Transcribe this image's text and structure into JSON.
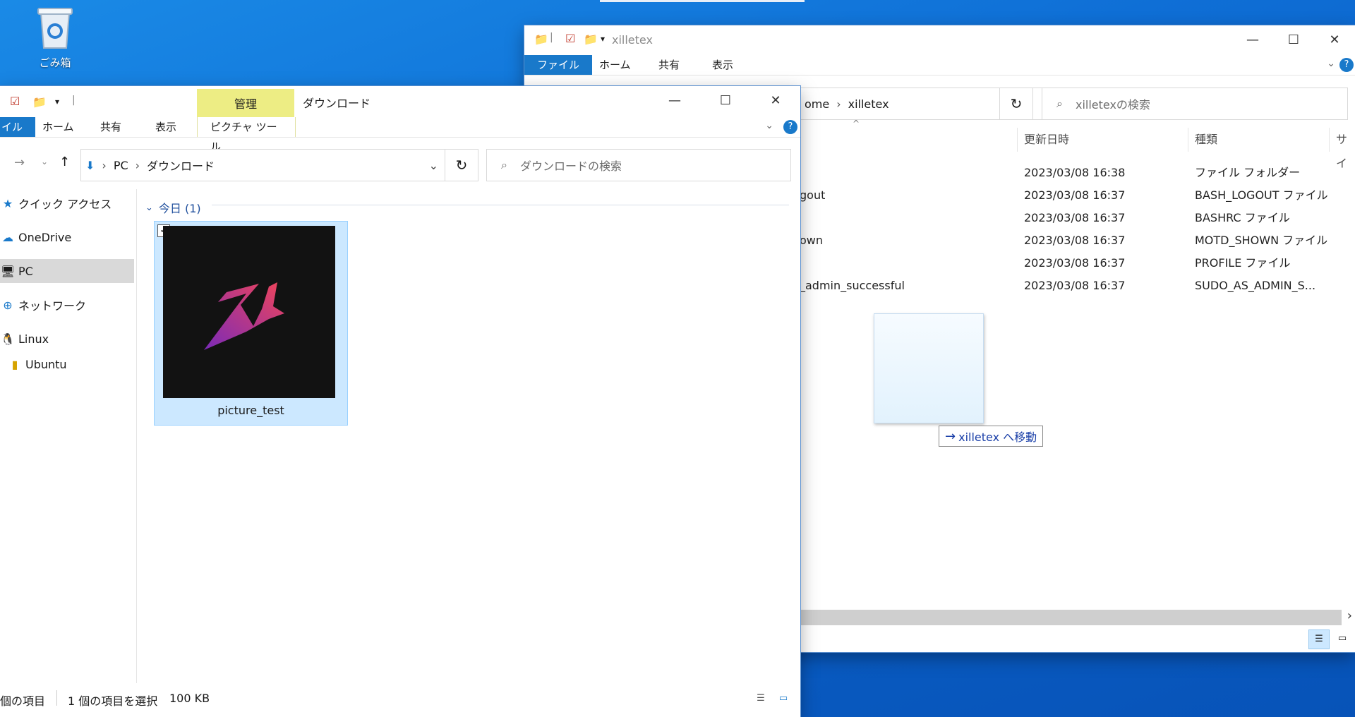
{
  "desktop": {
    "recycle_bin_label": "ごみ箱"
  },
  "back_window": {
    "title": "xilletex",
    "tabs": [
      "ファイル",
      "ホーム",
      "共有",
      "表示"
    ],
    "breadcrumb_prefix": "ome",
    "breadcrumb_current": "xilletex",
    "search_placeholder": "xilletexの検索",
    "columns": {
      "modified": "更新日時",
      "type": "種類",
      "size": "サイ"
    },
    "files": [
      {
        "name": "",
        "modified": "2023/03/08 16:38",
        "type": "ファイル フォルダー"
      },
      {
        "name": "gout",
        "modified": "2023/03/08 16:37",
        "type": "BASH_LOGOUT ファイル"
      },
      {
        "name": "",
        "modified": "2023/03/08 16:37",
        "type": "BASHRC ファイル"
      },
      {
        "name": "own",
        "modified": "2023/03/08 16:37",
        "type": "MOTD_SHOWN ファイル"
      },
      {
        "name": "",
        "modified": "2023/03/08 16:37",
        "type": "PROFILE ファイル"
      },
      {
        "name": "_admin_successful",
        "modified": "2023/03/08 16:37",
        "type": "SUDO_AS_ADMIN_S..."
      }
    ],
    "drag_tooltip": "xilletex へ移動"
  },
  "front_window": {
    "title": "ダウンロード",
    "manage_tab": "管理",
    "picture_tools_tab": "ピクチャ ツール",
    "tabs": [
      "イル",
      "ホーム",
      "共有",
      "表示"
    ],
    "breadcrumb": [
      "PC",
      "ダウンロード"
    ],
    "search_placeholder": "ダウンロードの検索",
    "nav": [
      "クイック アクセス",
      "OneDrive",
      "PC",
      "ネットワーク",
      "Linux",
      "Ubuntu"
    ],
    "group_label": "今日 (1)",
    "file_name": "picture_test",
    "status": {
      "count": "個の項目",
      "selected": "1 個の項目を選択",
      "size": "100 KB"
    }
  },
  "colors": {
    "file_tab": "#1979ca",
    "manage_tab_bg": "#eded84",
    "selection": "#cce8ff"
  }
}
